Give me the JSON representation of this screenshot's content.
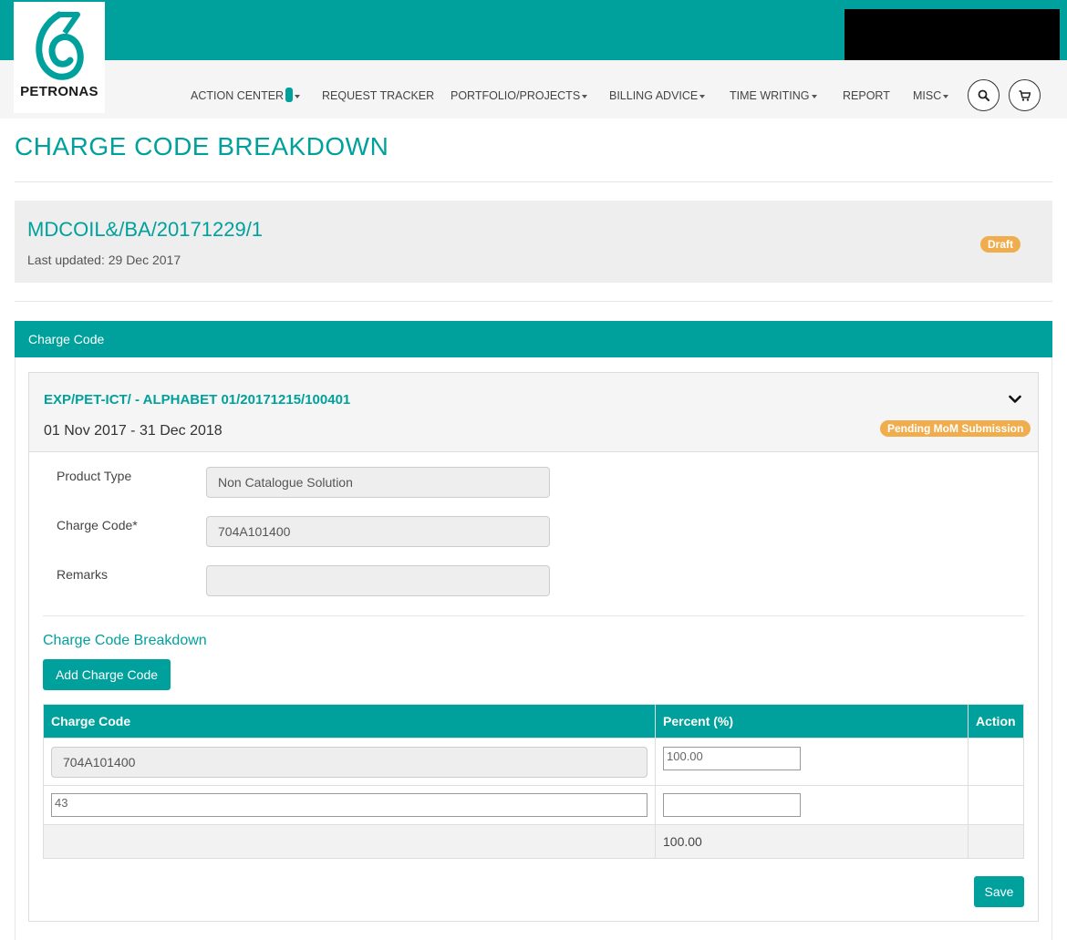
{
  "brand": {
    "logo_text": "PETRONAS"
  },
  "nav": {
    "items": [
      {
        "label": "ACTION CENTER",
        "has_caret": true
      },
      {
        "label": "REQUEST TRACKER",
        "has_caret": false
      },
      {
        "label": "PORTFOLIO/PROJECTS",
        "has_caret": true
      },
      {
        "label": "BILLING ADVICE",
        "has_caret": true
      },
      {
        "label": "TIME WRITING",
        "has_caret": true
      },
      {
        "label": "REPORT",
        "has_caret": false
      },
      {
        "label": "MISC",
        "has_caret": true
      }
    ],
    "search_icon": "search-icon",
    "cart_icon": "cart-icon"
  },
  "page": {
    "title": "CHARGE CODE BREAKDOWN"
  },
  "document": {
    "id": "MDCOIL&/BA/20171229/1",
    "last_updated": "Last updated: 29 Dec 2017",
    "status": "Draft"
  },
  "panel": {
    "title": "Charge Code",
    "item": {
      "code": "EXP/PET-ICT/ - ALPHABET 01/20171215/100401",
      "dates": "01 Nov 2017 - 31 Dec 2018",
      "status": "Pending MoM Submission"
    },
    "form": {
      "product_type_label": "Product Type",
      "product_type_value": "Non Catalogue Solution",
      "charge_code_label": "Charge Code*",
      "charge_code_value": "704A101400",
      "remarks_label": "Remarks",
      "remarks_value": ""
    },
    "breakdown": {
      "title": "Charge Code Breakdown",
      "add_button": "Add Charge Code",
      "columns": [
        "Charge Code",
        "Percent (%)",
        "Action"
      ],
      "rows": [
        {
          "charge_code": "704A101400",
          "percent": "100.00"
        },
        {
          "charge_code": "43",
          "percent": ""
        }
      ],
      "total": "100.00"
    },
    "save_button": "Save"
  },
  "colors": {
    "brand": "#00a19c",
    "badge": "#f0ad4e"
  }
}
